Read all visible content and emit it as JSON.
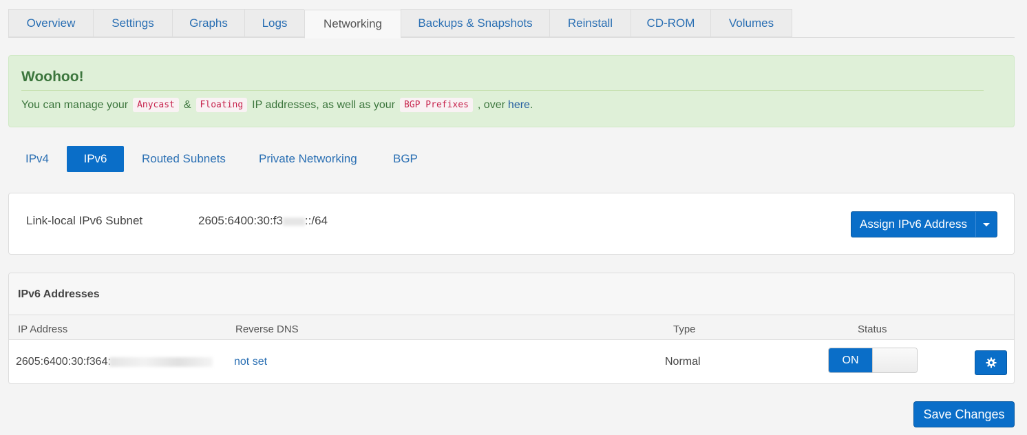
{
  "top_tabs": [
    {
      "label": "Overview",
      "width": 123
    },
    {
      "label": "Settings",
      "width": 115
    },
    {
      "label": "Graphs",
      "width": 105
    },
    {
      "label": "Logs",
      "width": 87
    },
    {
      "label": "Networking",
      "width": 140,
      "active": true
    },
    {
      "label": "Backups & Snapshots",
      "width": 216
    },
    {
      "label": "Reinstall",
      "width": 118
    },
    {
      "label": "CD-ROM",
      "width": 116
    },
    {
      "label": "Volumes",
      "width": 119
    }
  ],
  "alert": {
    "title": "Woohoo!",
    "text_before": "You can manage your",
    "code1": "Anycast",
    "amp": "&",
    "code2": "Floating",
    "text_mid": "IP addresses, as well as your",
    "code3": "BGP Prefixes",
    "text_after": ", over",
    "link": "here",
    "period": "."
  },
  "sub_tabs": {
    "ipv4": "IPv4",
    "ipv6": "IPv6",
    "routed": "Routed Subnets",
    "private": "Private Networking",
    "bgp": "BGP"
  },
  "subnet": {
    "label": "Link-local IPv6 Subnet",
    "value_prefix": "2605:6400:30:f3",
    "value_suffix": "::/64",
    "assign_button": "Assign IPv6 Address"
  },
  "ipv6_table": {
    "title": "IPv6 Addresses",
    "columns": {
      "ip": "IP Address",
      "rdns": "Reverse DNS",
      "type": "Type",
      "status": "Status"
    },
    "rows": [
      {
        "ip_prefix": "2605:6400:30:f364:",
        "rdns": "not set",
        "type": "Normal",
        "status": "ON"
      }
    ]
  },
  "save_button": "Save Changes",
  "colors": {
    "primary": "#0a6ec8",
    "link": "#2a6fb3",
    "alert_bg": "#dff0d8",
    "alert_text": "#3c763d"
  },
  "icons": {
    "gear": "gear-icon",
    "caret": "caret-down-icon"
  }
}
